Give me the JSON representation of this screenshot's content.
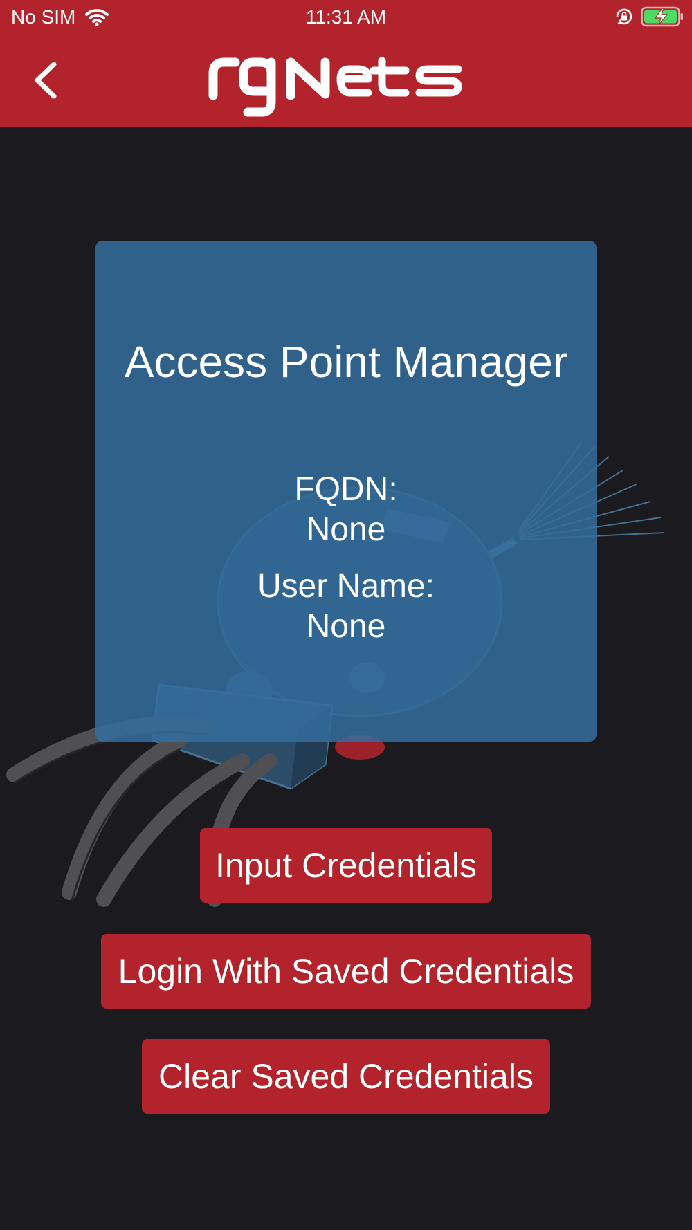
{
  "status_bar": {
    "carrier": "No SIM",
    "time": "11:31 AM",
    "icons": [
      "wifi-icon",
      "orientation-lock-icon",
      "battery-charging-icon"
    ],
    "battery_color": "#4cd964"
  },
  "header": {
    "back_icon": "chevron-left-icon",
    "logo_text": "rgNets"
  },
  "card": {
    "title": "Access Point Manager",
    "fqdn_label": "FQDN:",
    "fqdn_value": "None",
    "username_label": "User Name:",
    "username_value": "None"
  },
  "buttons": {
    "input_credentials": "Input Credentials",
    "login_saved": "Login With Saved Credentials",
    "clear_saved": "Clear Saved Credentials"
  },
  "colors": {
    "brand_red": "#b3232c",
    "background": "#1b1a1f",
    "card_blue": "#2f6a95"
  }
}
